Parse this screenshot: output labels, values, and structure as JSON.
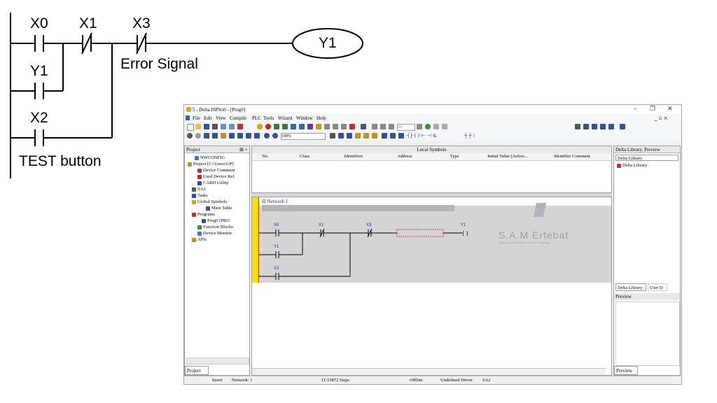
{
  "ladder": {
    "contacts": [
      "X0",
      "X1",
      "X3",
      "Y1",
      "X2"
    ],
    "coil": "Y1",
    "error_note": "Error Signal",
    "test_note": "TEST button"
  },
  "window": {
    "title": "5 - Delta ISPSoft - [Prog0]",
    "menu": [
      "File",
      "Edit",
      "View",
      "Compile",
      "PLC",
      "Tools",
      "Wizard",
      "Window",
      "Help"
    ],
    "zoom": "100%",
    "step_field": "10"
  },
  "project_panel": {
    "title": "Project",
    "tab": "Project",
    "items": [
      "NWCONFIG",
      "Project [C:\\Users\\UPC",
      "Device Comment",
      "Used Device Ref",
      "CARD Utility",
      "SA2",
      "Tasks",
      "Global Symbols",
      "Main Table",
      "Programs",
      "Prog0 [PRO",
      "Function Blocks",
      "Device Monitor",
      "APIs"
    ]
  },
  "local_symbols": {
    "title": "Local Symbols",
    "columns": [
      "No.",
      "Class",
      "Identifiers",
      "Address",
      "Type",
      "Initial Value (Active...",
      "Identifier Comment"
    ]
  },
  "network": {
    "label": "Network 1",
    "contacts": [
      "X0",
      "X1",
      "X3",
      "Y1",
      "X2"
    ],
    "coil": "Y1"
  },
  "watermark": {
    "name": "S.A.M Ertebat",
    "tagline": "Sana Arvande Modiran Ertebat Company"
  },
  "library": {
    "header": "Delta Library, Preview",
    "dropdown": "Delta Library",
    "item": "Delta Library",
    "tab1": "Delta Library",
    "tab2": "User D",
    "preview_title": "Preview",
    "preview_tab": "Preview"
  },
  "status": {
    "mode": "Insert",
    "network": "Network: 1",
    "steps": "11/15872 Steps",
    "online": "Offline",
    "driver": "Undefined Driver",
    "model": "SA2"
  },
  "colors": {
    "watermark": "#9aa0a8",
    "highlight_box": "#d04040",
    "gutter": "#f5e000",
    "rung_bg": "#d4d4d4"
  }
}
